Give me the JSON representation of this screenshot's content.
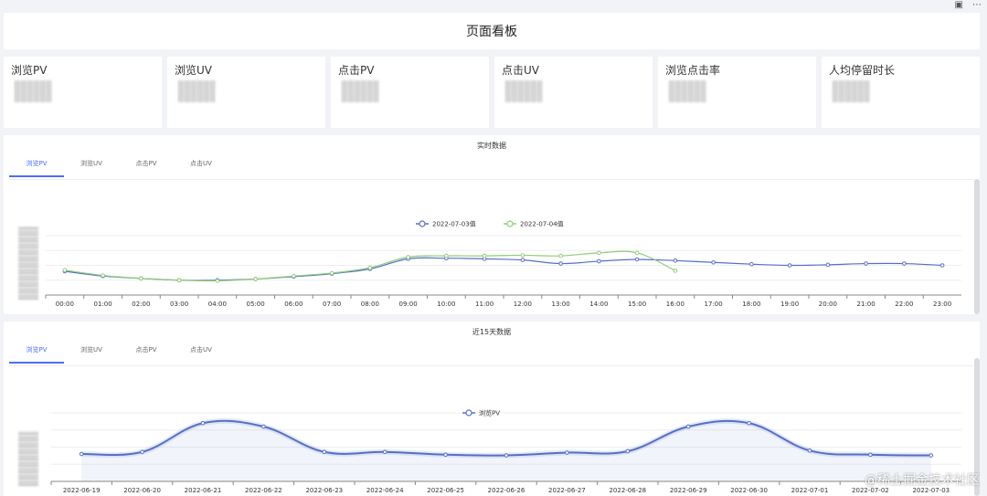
{
  "toolbar": {
    "icon1": "grid-icon",
    "icon2": "more-icon"
  },
  "dashboard": {
    "title": "页面看板"
  },
  "cards": [
    {
      "label": "浏览PV"
    },
    {
      "label": "浏览UV"
    },
    {
      "label": "点击PV"
    },
    {
      "label": "点击UV"
    },
    {
      "label": "浏览点击率"
    },
    {
      "label": "人均停留时长"
    }
  ],
  "realtime": {
    "title": "实时数据",
    "tabs": [
      "浏览PV",
      "浏览UV",
      "点击PV",
      "点击UV"
    ],
    "active_tab": 0
  },
  "recent": {
    "title": "近15天数据",
    "tabs": [
      "浏览PV",
      "浏览UV",
      "点击PV",
      "点击UV"
    ],
    "active_tab": 0
  },
  "watermark": "@稀土掘金技术社区",
  "chart_data": [
    {
      "type": "line",
      "categories": [
        "00:00",
        "01:00",
        "02:00",
        "03:00",
        "04:00",
        "05:00",
        "06:00",
        "07:00",
        "08:00",
        "09:00",
        "10:00",
        "11:00",
        "12:00",
        "13:00",
        "14:00",
        "15:00",
        "16:00",
        "17:00",
        "18:00",
        "19:00",
        "20:00",
        "21:00",
        "22:00",
        "23:00"
      ],
      "series": [
        {
          "name": "2022-07-03值",
          "color": "#5470c6",
          "values": [
            40,
            32,
            28,
            25,
            25,
            27,
            31,
            36,
            44,
            61,
            62,
            61,
            59,
            53,
            57,
            60,
            58,
            55,
            52,
            50,
            51,
            53,
            53,
            50
          ]
        },
        {
          "name": "2022-07-04值",
          "color": "#91cc75",
          "values": [
            42,
            33,
            28,
            25,
            24,
            27,
            32,
            37,
            46,
            64,
            66,
            66,
            67,
            66,
            71,
            71,
            41
          ]
        }
      ],
      "ylim": [
        0,
        100
      ],
      "legend": "top-center",
      "grid": true
    },
    {
      "type": "area",
      "categories": [
        "2022-06-19",
        "2022-06-20",
        "2022-06-21",
        "2022-06-22",
        "2022-06-23",
        "2022-06-24",
        "2022-06-25",
        "2022-06-26",
        "2022-06-27",
        "2022-06-28",
        "2022-06-29",
        "2022-06-30",
        "2022-07-01",
        "2022-07-02",
        "2022-07-03"
      ],
      "series": [
        {
          "name": "浏览PV",
          "color": "#5470c6",
          "values": [
            40,
            43,
            85,
            80,
            43,
            43,
            39,
            38,
            42,
            44,
            80,
            85,
            45,
            39,
            38
          ]
        }
      ],
      "ylim": [
        0,
        100
      ],
      "legend": "top-center",
      "grid": true
    }
  ]
}
